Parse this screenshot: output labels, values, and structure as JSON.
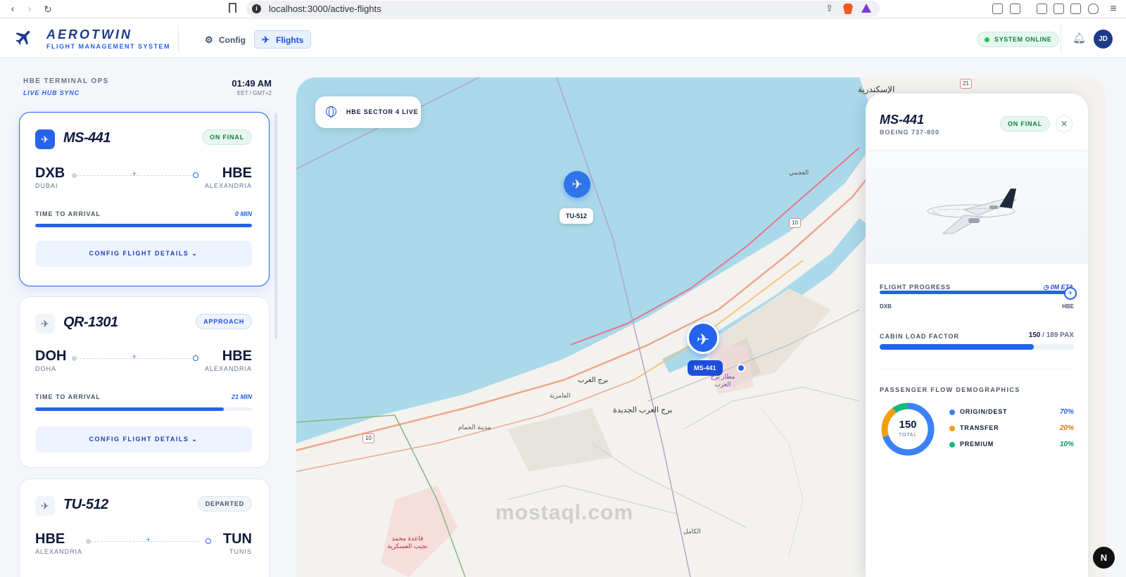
{
  "browser": {
    "url": "localhost:3000/active-flights"
  },
  "header": {
    "brand": "AEROTWIN",
    "subtitle": "FLIGHT MANAGEMENT SYSTEM",
    "nav": [
      {
        "label": "Config",
        "icon": "gear-icon",
        "active": false
      },
      {
        "label": "Flights",
        "icon": "plane-icon",
        "active": true
      }
    ],
    "status": "SYSTEM ONLINE",
    "avatar_initials": "JD"
  },
  "sidebar": {
    "title": "HBE TERMINAL OPS",
    "subtitle": "LIVE HUB SYNC",
    "time": "01:49 AM",
    "timezone": "EET / GMT+2",
    "flights": [
      {
        "id": "MS-441",
        "status": "ON FINAL",
        "status_color": "green",
        "from": "DXB",
        "from_city": "DUBAI",
        "to": "HBE",
        "to_city": "ALEXANDRIA",
        "tta_label": "TIME TO ARRIVAL",
        "tta": "0 MIN",
        "progress": 1.0,
        "button": "CONFIG FLIGHT DETAILS",
        "selected": true
      },
      {
        "id": "QR-1301",
        "status": "APPROACH",
        "status_color": "blue",
        "from": "DOH",
        "from_city": "DOHA",
        "to": "HBE",
        "to_city": "ALEXANDRIA",
        "tta_label": "TIME TO ARRIVAL",
        "tta": "21 MIN",
        "progress": 0.87,
        "button": "CONFIG FLIGHT DETAILS",
        "selected": false
      },
      {
        "id": "TU-512",
        "status": "DEPARTED",
        "status_color": "gray",
        "from": "HBE",
        "from_city": "ALEXANDRIA",
        "to": "TUN",
        "to_city": "TUNIS",
        "selected": false
      }
    ]
  },
  "map": {
    "sector_label": "HBE SECTOR 4 LIVE",
    "markers": [
      {
        "label": "TU-512"
      },
      {
        "label": "MS-441"
      }
    ],
    "place_labels": [
      "الإسكندرية",
      "برج العرب",
      "برج العرب الجديدة",
      "قاعدة محمد نجيب العسكرية",
      "مطار برج العرب",
      "مدينة الحمام",
      "العامرية",
      "الكامل",
      "العجمي"
    ],
    "road_shields": [
      "10",
      "10",
      "21"
    ],
    "watermark": "mostaql.com"
  },
  "detail": {
    "id": "MS-441",
    "aircraft": "BOEING 737-800",
    "status": "ON FINAL",
    "progress_label": "FLIGHT PROGRESS",
    "eta": "0M ETA",
    "progress": 1.0,
    "from": "DXB",
    "to": "HBE",
    "load_label": "CABIN LOAD FACTOR",
    "pax": "150",
    "pax_capacity": "/ 189 PAX",
    "load": 0.794,
    "demographics_label": "PASSENGER FLOW DEMOGRAPHICS",
    "total": "150",
    "total_label": "TOTAL",
    "segments": [
      {
        "name": "ORIGIN/DEST",
        "pct": "70%",
        "value": 70,
        "color": "#3b82f6"
      },
      {
        "name": "TRANSFER",
        "pct": "20%",
        "value": 20,
        "color": "#f59e0b"
      },
      {
        "name": "PREMIUM",
        "pct": "10%",
        "value": 10,
        "color": "#10b981"
      }
    ]
  },
  "floating_button": "N"
}
